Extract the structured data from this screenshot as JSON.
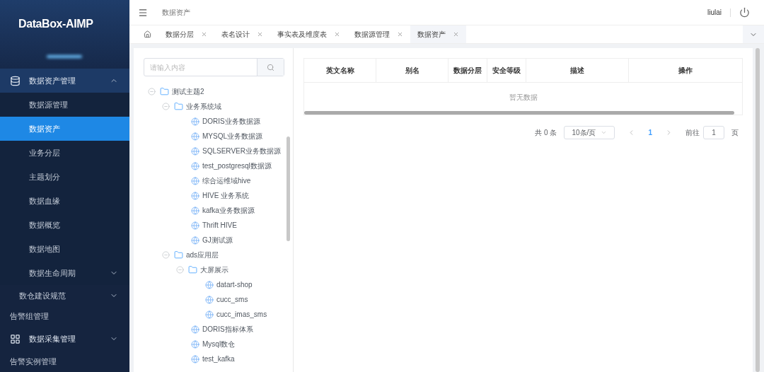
{
  "logo": {
    "text": "DataBox-AIMP"
  },
  "sidebar": {
    "items": [
      {
        "label": "数据资产管理",
        "kind": "group",
        "expanded": true,
        "children": [
          {
            "label": "数据源管理",
            "selected": false
          },
          {
            "label": "数据资产",
            "selected": true
          },
          {
            "label": "业务分层",
            "selected": false
          },
          {
            "label": "主题划分",
            "selected": false
          },
          {
            "label": "数据血缘",
            "selected": false
          },
          {
            "label": "数据概览",
            "selected": false
          },
          {
            "label": "数据地图",
            "selected": false
          },
          {
            "label": "数据生命周期",
            "selected": false,
            "expanded": false
          }
        ]
      },
      {
        "label": "数仓建设规范",
        "kind": "subgroup",
        "expanded": false
      },
      {
        "label": "告警组管理",
        "kind": "link"
      },
      {
        "label": "数据采集管理",
        "kind": "group",
        "expanded": false
      },
      {
        "label": "告警实例管理",
        "kind": "link"
      }
    ]
  },
  "header": {
    "breadcrumb": "数据资产",
    "user": "liulai"
  },
  "tabs": [
    {
      "label": "数据分层",
      "selected": false
    },
    {
      "label": "表名设计",
      "selected": false
    },
    {
      "label": "事实表及维度表",
      "selected": false
    },
    {
      "label": "数据源管理",
      "selected": false
    },
    {
      "label": "数据资产",
      "selected": true
    }
  ],
  "search": {
    "placeholder": "请输入内容"
  },
  "tree": [
    {
      "label": "测试主题2",
      "kind": "folder",
      "expanded": true,
      "children": [
        {
          "label": "业务系统域",
          "kind": "folder",
          "expanded": true,
          "children": [
            {
              "label": "DORIS业务数据源",
              "kind": "source"
            },
            {
              "label": "MYSQL业务数据源",
              "kind": "source"
            },
            {
              "label": "SQLSERVER业务数据源",
              "kind": "source"
            },
            {
              "label": "test_postgresql数据源",
              "kind": "source"
            },
            {
              "label": "综合运维域hive",
              "kind": "source"
            },
            {
              "label": "HIVE 业务系统",
              "kind": "source"
            },
            {
              "label": "kafka业务数据源",
              "kind": "source"
            },
            {
              "label": "Thrift HIVE",
              "kind": "source"
            },
            {
              "label": "GJ测试源",
              "kind": "source"
            }
          ]
        },
        {
          "label": "ads应用层",
          "kind": "folder",
          "expanded": true,
          "children": [
            {
              "label": "大屏展示",
              "kind": "folder",
              "expanded": true,
              "children": [
                {
                  "label": "datart-shop",
                  "kind": "source"
                },
                {
                  "label": "cucc_sms",
                  "kind": "source"
                },
                {
                  "label": "cucc_imas_sms",
                  "kind": "source"
                }
              ]
            },
            {
              "label": "DORIS指标体系",
              "kind": "source"
            },
            {
              "label": "Mysql数仓",
              "kind": "source"
            },
            {
              "label": "test_kafka",
              "kind": "source"
            }
          ]
        }
      ]
    }
  ],
  "table": {
    "columns": [
      "英文名称",
      "别名",
      "数据分层",
      "安全等级",
      "描述",
      "操作"
    ],
    "empty_text": "暂无数据"
  },
  "pagination": {
    "total": "共 0 条",
    "page_size": "10条/页",
    "pages": [
      {
        "label": "1",
        "selected": true
      }
    ],
    "goto_label": "前往",
    "goto_value": "1",
    "page_suffix": "页"
  }
}
